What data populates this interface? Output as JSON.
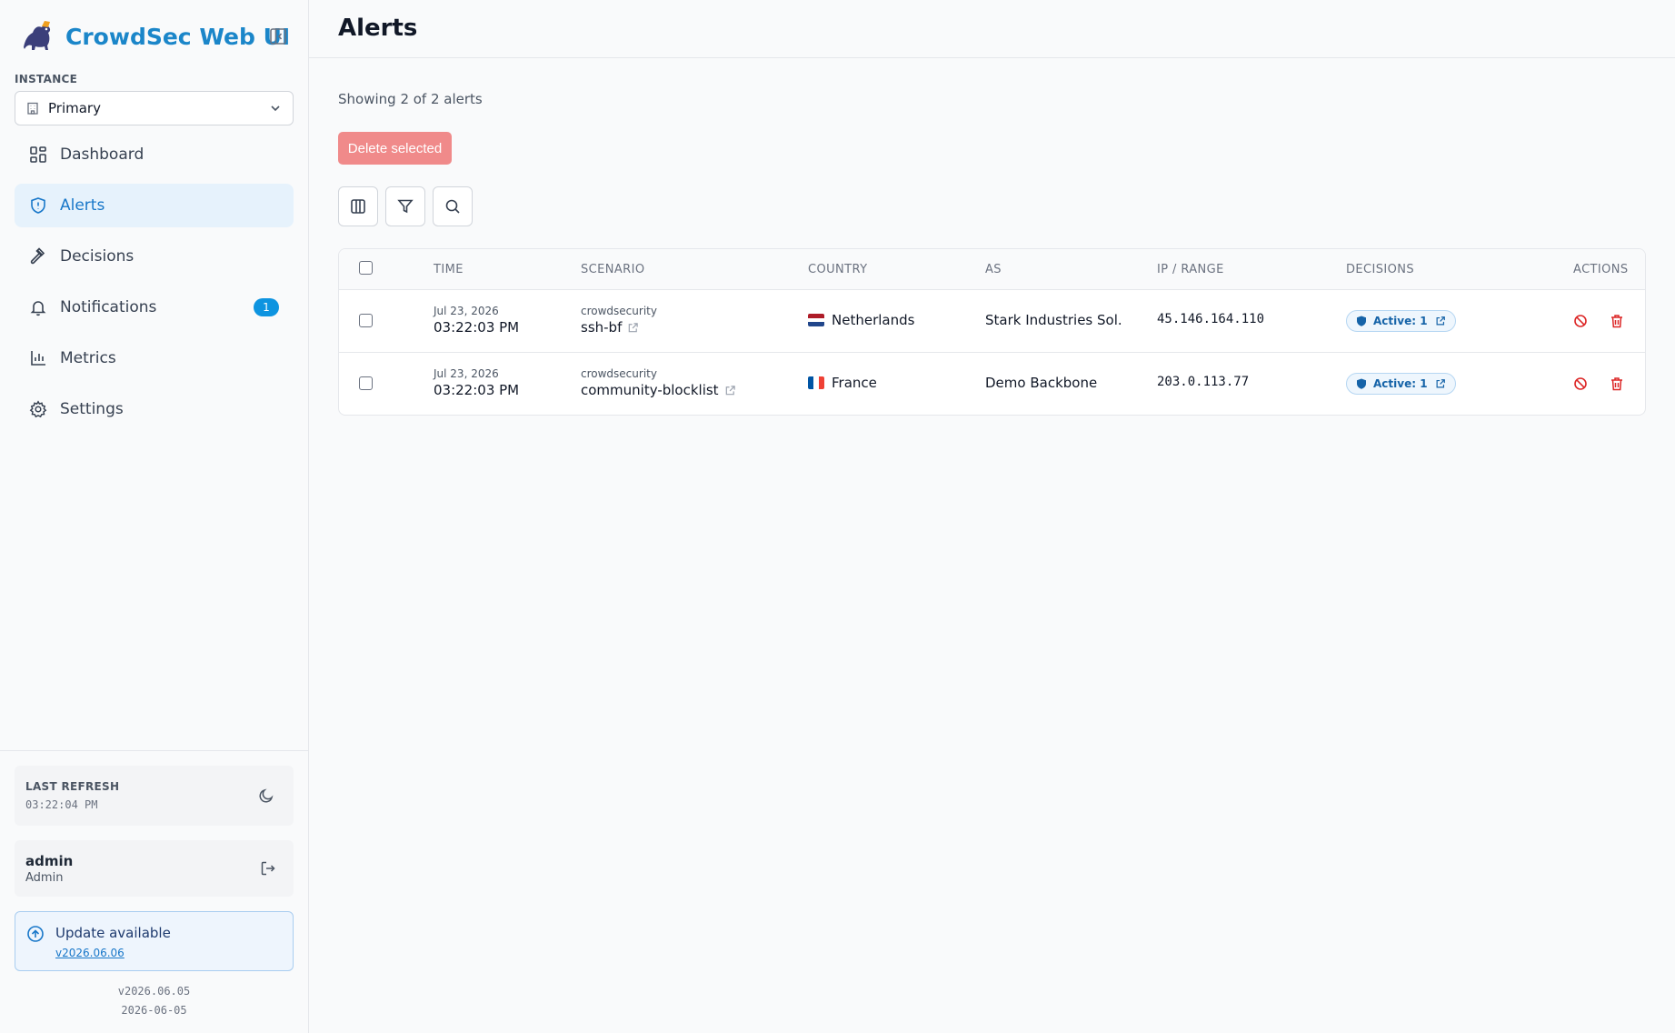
{
  "app": {
    "title": "CrowdSec Web UI"
  },
  "instance": {
    "label": "INSTANCE",
    "selected": "Primary"
  },
  "nav": {
    "items": [
      {
        "label": "Dashboard"
      },
      {
        "label": "Alerts"
      },
      {
        "label": "Decisions"
      },
      {
        "label": "Notifications",
        "badge": "1"
      },
      {
        "label": "Metrics"
      },
      {
        "label": "Settings"
      }
    ]
  },
  "status": {
    "label": "LAST REFRESH",
    "time": "03:22:04 PM"
  },
  "user": {
    "name": "admin",
    "role": "Admin"
  },
  "update": {
    "title": "Update available",
    "version": "v2026.06.06"
  },
  "footer": {
    "version": "v2026.06.05",
    "date": "2026-06-05"
  },
  "page": {
    "title": "Alerts",
    "showing": "Showing 2 of 2 alerts",
    "delete_label": "Delete selected"
  },
  "table": {
    "headers": {
      "time": "TIME",
      "scenario": "SCENARIO",
      "country": "COUNTRY",
      "as": "AS",
      "ip": "IP / RANGE",
      "decisions": "DECISIONS",
      "actions": "ACTIONS"
    },
    "rows": [
      {
        "date": "Jul 23, 2026",
        "time": "03:22:03 PM",
        "namespace": "crowdsecurity",
        "scenario": "ssh-bf",
        "country": "Netherlands",
        "as": "Stark Industries Sol...",
        "ip": "45.146.164.110",
        "decision": "Active: 1"
      },
      {
        "date": "Jul 23, 2026",
        "time": "03:22:03 PM",
        "namespace": "crowdsecurity",
        "scenario": "community-blocklist",
        "country": "France",
        "as": "Demo Backbone",
        "ip": "203.0.113.77",
        "decision": "Active: 1"
      }
    ]
  },
  "colors": {
    "brand": "#1b86c9",
    "accent": "#0e94e0",
    "danger": "#dc2626",
    "delete_button": "#f08a8a"
  }
}
